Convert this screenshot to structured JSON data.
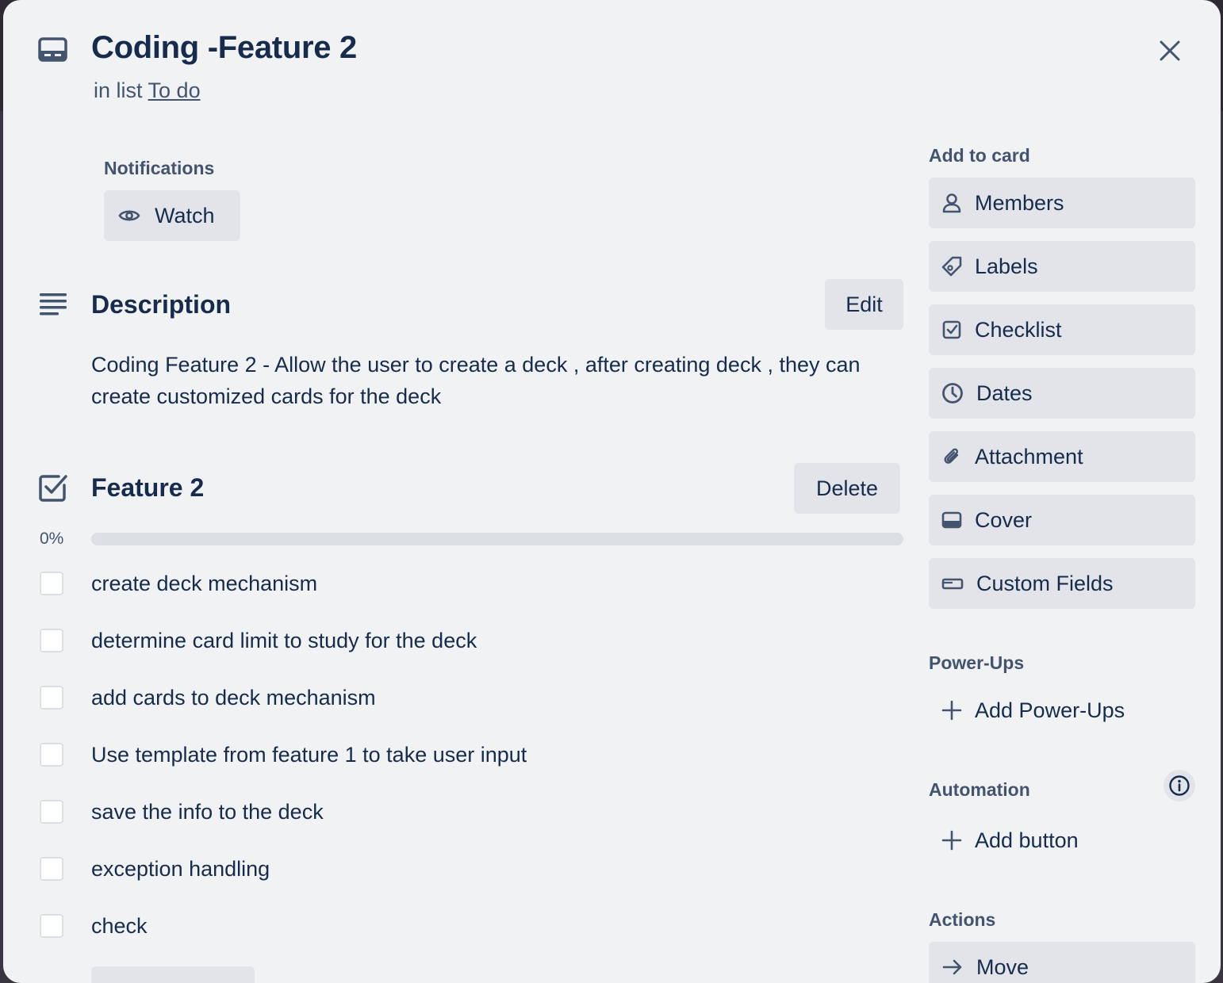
{
  "card": {
    "title": "Coding -Feature 2",
    "list_prefix": "in list ",
    "list_name": "To do",
    "icon": "card-icon"
  },
  "notifications": {
    "heading": "Notifications",
    "watch_label": "Watch",
    "watch_icon": "eye-icon"
  },
  "description": {
    "heading": "Description",
    "edit_label": "Edit",
    "text": "Coding Feature 2 - Allow the user to create a deck , after creating deck , they can create customized cards for the deck"
  },
  "checklist": {
    "title": "Feature 2",
    "delete_label": "Delete",
    "progress_label": "0%",
    "progress": 0,
    "items": [
      {
        "text": "create deck mechanism",
        "checked": false
      },
      {
        "text": "determine card limit to study for the deck",
        "checked": false
      },
      {
        "text": "add cards to deck mechanism",
        "checked": false
      },
      {
        "text": "Use template from feature 1 to take user input",
        "checked": false
      },
      {
        "text": "save the info to the deck",
        "checked": false
      },
      {
        "text": "exception handling",
        "checked": false
      },
      {
        "text": "check",
        "checked": false
      }
    ]
  },
  "sidebar": {
    "add_to_card_heading": "Add to card",
    "add_to_card": [
      {
        "label": "Members",
        "icon": "person-icon"
      },
      {
        "label": "Labels",
        "icon": "tag-icon"
      },
      {
        "label": "Checklist",
        "icon": "checklist-icon"
      },
      {
        "label": "Dates",
        "icon": "clock-icon"
      },
      {
        "label": "Attachment",
        "icon": "paperclip-icon"
      },
      {
        "label": "Cover",
        "icon": "cover-icon"
      },
      {
        "label": "Custom Fields",
        "icon": "custom-fields-icon"
      }
    ],
    "power_ups_heading": "Power-Ups",
    "add_power_ups_label": "Add Power-Ups",
    "automation_heading": "Automation",
    "add_button_label": "Add button",
    "actions_heading": "Actions",
    "move_label": "Move"
  },
  "colors": {
    "text": "#172b4d",
    "subtle_text": "#44546f",
    "button_bg": "#e2e4e9",
    "modal_bg": "#f1f2f4",
    "progress_track": "#dcdfe4"
  }
}
